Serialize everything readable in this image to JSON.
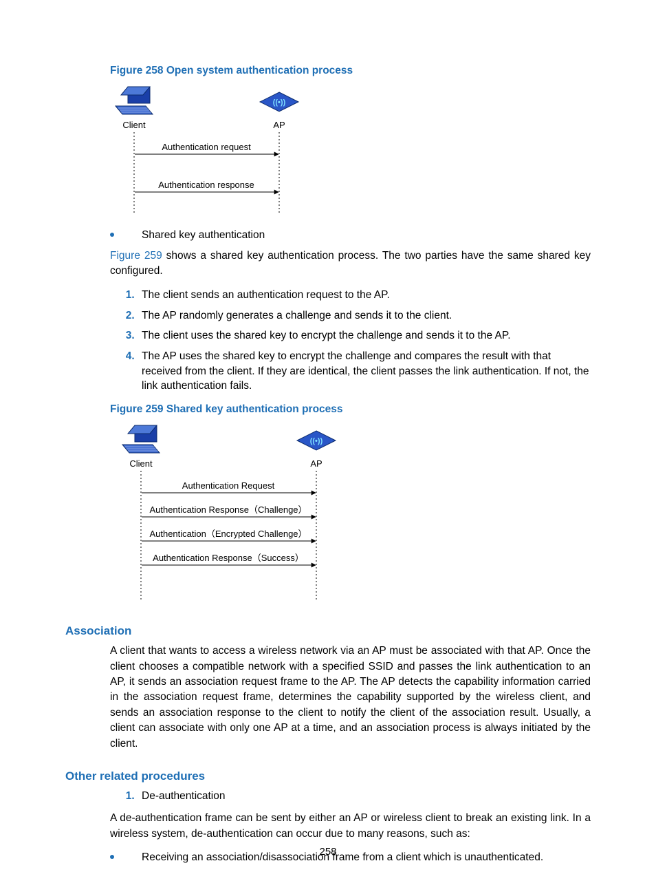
{
  "fig258": {
    "caption": "Figure 258 Open system authentication process",
    "left_label": "Client",
    "right_label": "AP",
    "left_icon": "laptop-icon",
    "right_icon": "access-point-icon",
    "messages": [
      {
        "text": "Authentication request",
        "dir": "right"
      },
      {
        "text": "Authentication response",
        "dir": "left"
      }
    ]
  },
  "bullet_shared_key": "Shared key authentication",
  "para_fig259_intro": {
    "xref": "Figure 259",
    "rest": " shows a shared key authentication process. The two parties have the same shared key configured."
  },
  "steps": [
    "The client sends an authentication request to the AP.",
    "The AP randomly generates a challenge and sends it to the client.",
    "The client uses the shared key to encrypt the challenge and sends it to the AP.",
    "The AP uses the shared key to encrypt the challenge and compares the result with that received from the client. If they are identical, the client passes the link authentication. If not, the link authentication fails."
  ],
  "fig259": {
    "caption": "Figure 259 Shared key authentication process",
    "left_label": "Client",
    "right_label": "AP",
    "left_icon": "laptop-icon",
    "right_icon": "access-point-icon",
    "messages": [
      {
        "text": "Authentication Request",
        "dir": "right"
      },
      {
        "text": "Authentication Response（Challenge）",
        "dir": "left"
      },
      {
        "text": "Authentication（Encrypted Challenge）",
        "dir": "right"
      },
      {
        "text": "Authentication Response（Success）",
        "dir": "left"
      }
    ]
  },
  "sec_assoc": {
    "heading": "Association",
    "body": "A client that wants to access a wireless network via an AP must be associated with that AP. Once the client chooses a compatible network with a specified SSID and passes the link authentication to an AP, it sends an association request frame to the AP. The AP detects the capability information carried in the association request frame, determines the capability supported by the wireless client, and sends an association response to the client to notify the client of the association result. Usually, a client can associate with only one AP at a time, and an association process is always initiated by the client."
  },
  "sec_other": {
    "heading": "Other related procedures",
    "num1_label": "De-authentication",
    "para": "A de-authentication frame can be sent by either an AP or wireless client to break an existing link. In a wireless system, de-authentication can occur due to many reasons, such as:",
    "bullet": "Receiving an association/disassociation frame from a client which is unauthenticated."
  },
  "page_number": "258"
}
